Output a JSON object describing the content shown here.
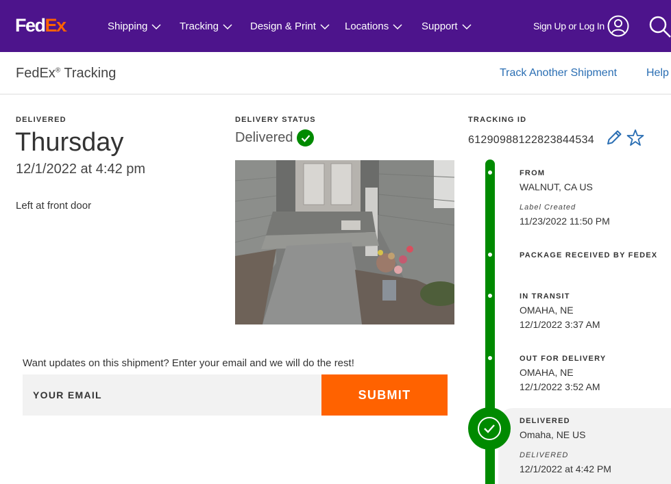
{
  "nav": {
    "logo_fed": "Fed",
    "logo_ex": "Ex",
    "logo_dot": ".",
    "items": [
      {
        "label": "Shipping"
      },
      {
        "label": "Tracking"
      },
      {
        "label": "Design & Print"
      },
      {
        "label": "Locations"
      },
      {
        "label": "Support"
      }
    ],
    "signin": "Sign Up or Log In"
  },
  "subheader": {
    "title": "FedEx",
    "title_mark": "®",
    "title_suffix": " Tracking",
    "track_another": "Track Another Shipment",
    "help": "Help"
  },
  "delivery": {
    "label": "DELIVERED",
    "day": "Thursday",
    "datetime": "12/1/2022 at 4:42 pm",
    "location_note": "Left at front door"
  },
  "status": {
    "label": "DELIVERY STATUS",
    "value": "Delivered"
  },
  "signup": {
    "prompt": "Want updates on this shipment? Enter your email and we will do the rest!",
    "placeholder": "YOUR EMAIL",
    "submit": "SUBMIT"
  },
  "tracking": {
    "label": "TRACKING ID",
    "id": "61290988122823844534"
  },
  "timeline": {
    "from_title": "FROM",
    "from_location": "WALNUT, CA US",
    "label_created": "Label Created",
    "label_created_time": "11/23/2022 11:50 PM",
    "received": "PACKAGE RECEIVED BY FEDEX",
    "transit_title": "IN TRANSIT",
    "transit_location": "OMAHA, NE",
    "transit_time": "12/1/2022 3:37 AM",
    "ofd_title": "OUT FOR DELIVERY",
    "ofd_location": "OMAHA, NE",
    "ofd_time": "12/1/2022 3:52 AM",
    "delivered_title": "DELIVERED",
    "delivered_location": "Omaha, NE US",
    "delivered_sub": "DELIVERED",
    "delivered_time": "12/1/2022 at 4:42 PM"
  },
  "colors": {
    "brand_purple": "#4d148c",
    "brand_orange": "#ff6200",
    "success_green": "#008a00",
    "link_blue": "#2a6eb3"
  }
}
